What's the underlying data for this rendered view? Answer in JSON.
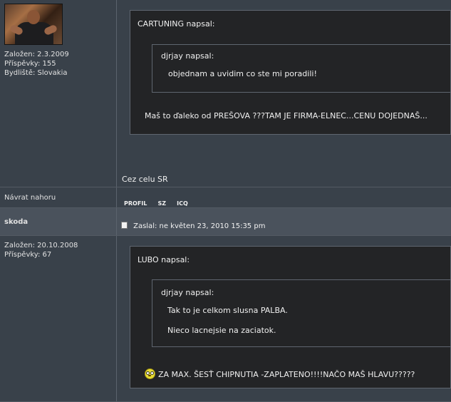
{
  "post1": {
    "joined": "Založen: 2.3.2009",
    "posts": "Příspěvky: 155",
    "location": "Bydliště: Slovakia",
    "quote_author": "CARTUNING napsal:",
    "nested_quote_author": "djrjay napsal:",
    "nested_quote_text": "objednam a uvidim co ste mi poradili!",
    "quote_text": "Maš to ďaleko od PREŠOVA ???TAM JE FIRMA-ELNEC...CENU DOJEDNAŠ...",
    "signature": "Cez celu SR"
  },
  "footer1": {
    "back_to_top": "Návrat nahoru",
    "profile_label": "PROFIL",
    "pm_label": "SZ",
    "icq_label": "ICQ"
  },
  "post2": {
    "author": "skoda",
    "posted": "Zaslal: ne květen 23, 2010 15:35 pm",
    "joined": "Založen: 20.10.2008",
    "posts": "Příspěvky: 67",
    "quote_author": "LUBO napsal:",
    "nested_quote_author": "djrjay napsal:",
    "nested_quote_text_1": "Tak to je celkom slusna PALBA.",
    "nested_quote_text_2": "Nieco lacnejsie na zaciatok.",
    "reply_text": "ZA MAX. ŠESŤ CHIPNUTIA -ZAPLATENO!!!!NAČO MAŠ HLAVU?????"
  }
}
